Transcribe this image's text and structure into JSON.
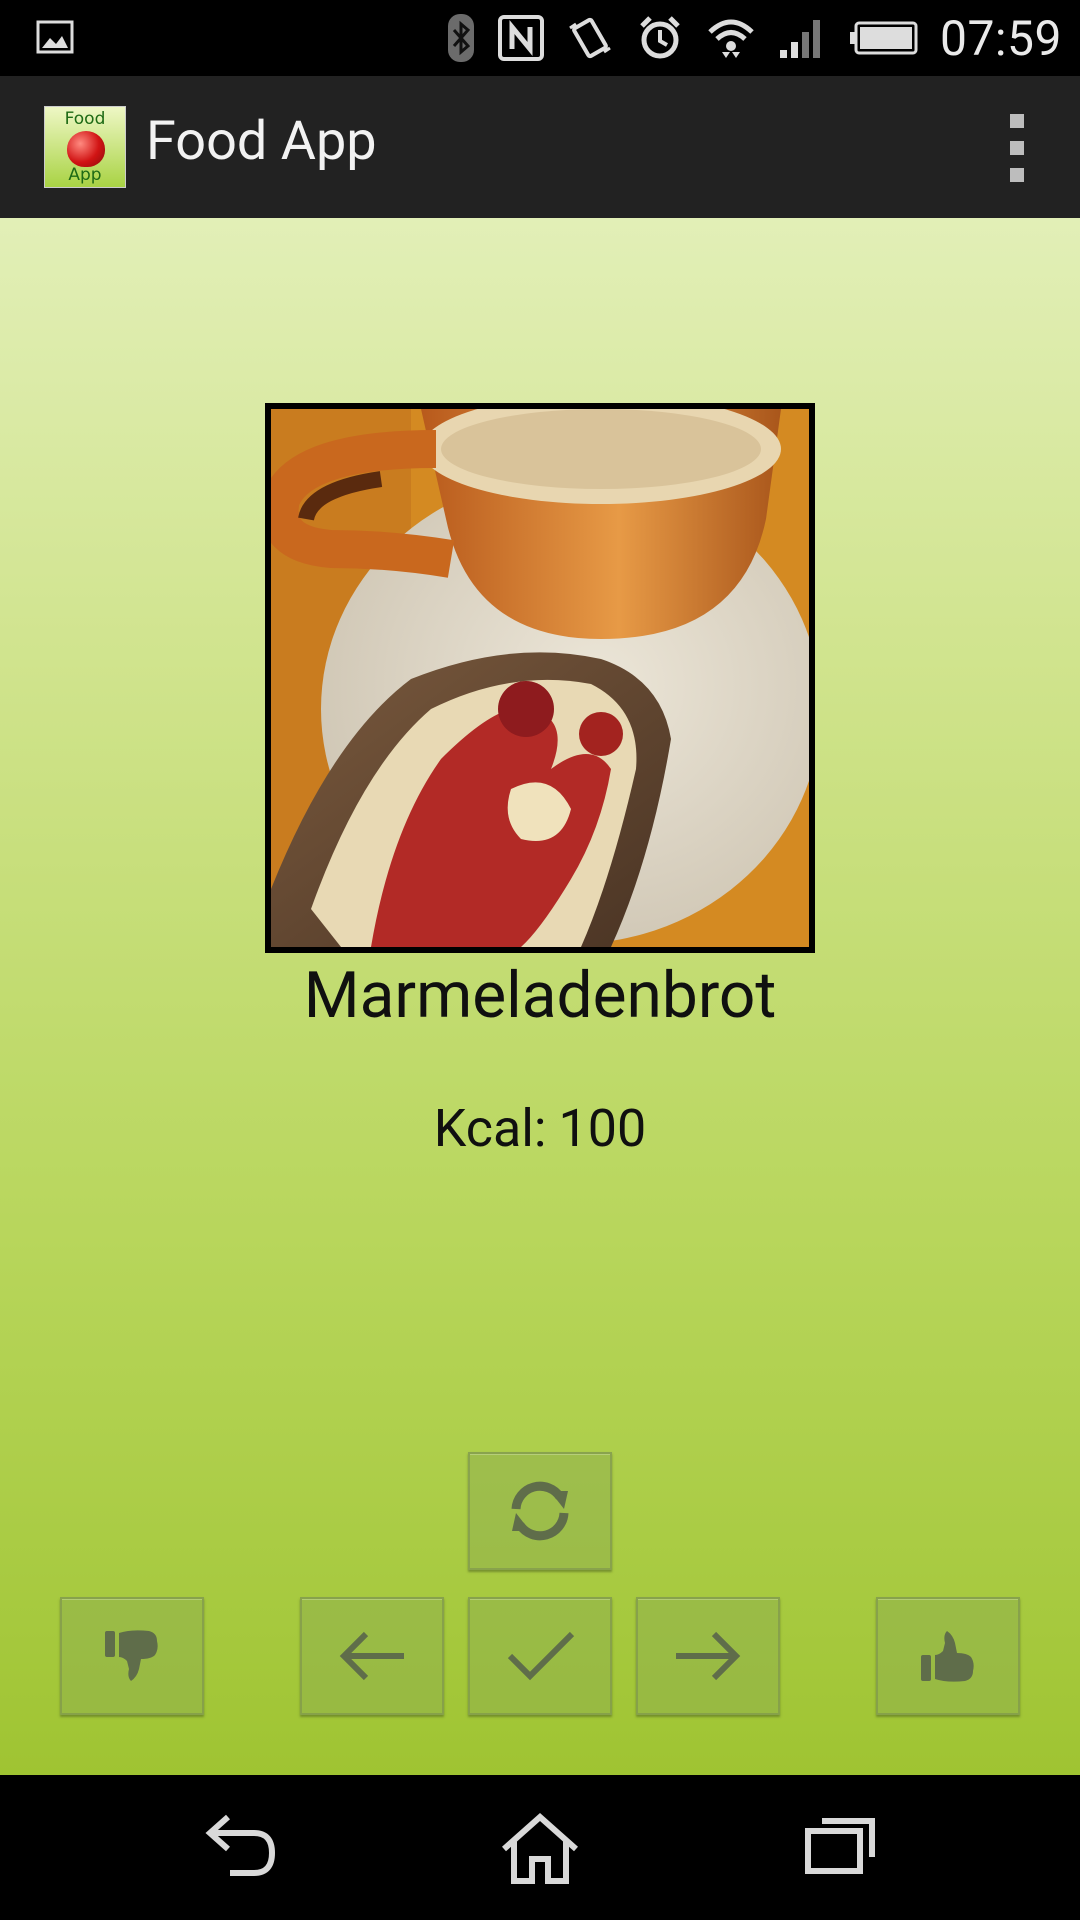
{
  "status_bar": {
    "time": "07:59",
    "icons": [
      "gallery-notification-icon",
      "bluetooth-icon",
      "nfc-icon",
      "vibrate-icon",
      "alarm-icon",
      "wifi-icon",
      "signal-icon",
      "battery-icon"
    ]
  },
  "action_bar": {
    "app_title": "Food App",
    "app_icon_text_top": "Food",
    "app_icon_text_bottom": "App",
    "overflow_icon": "overflow-menu-icon"
  },
  "food": {
    "name": "Marmeladenbrot",
    "kcal_label": "Kcal:",
    "kcal_value": "100"
  },
  "buttons": {
    "refresh": "refresh-icon",
    "dislike": "thumbs-down-icon",
    "previous": "arrow-left-icon",
    "confirm": "check-icon",
    "next": "arrow-right-icon",
    "like": "thumbs-up-icon"
  },
  "nav_bar": {
    "back": "back-icon",
    "home": "home-icon",
    "recents": "recents-icon"
  },
  "colors": {
    "background_top": "#e2efb7",
    "background_bottom": "#9fc432",
    "button_icon": "#5f6d4a"
  }
}
